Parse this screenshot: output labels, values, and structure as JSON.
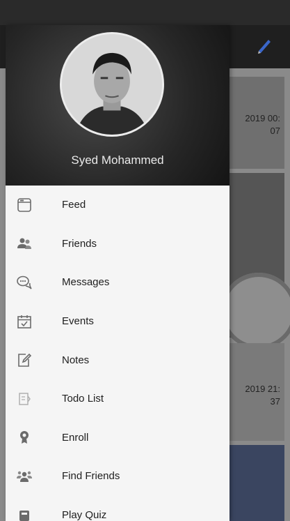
{
  "user": {
    "name": "Syed Mohammed"
  },
  "background": {
    "post_dates": [
      {
        "line1": "2019 00:",
        "line2": "07"
      },
      {
        "line1": "2019 21:",
        "line2": "37"
      }
    ]
  },
  "drawer": {
    "items": [
      {
        "label": "Feed",
        "icon": "feed-icon"
      },
      {
        "label": "Friends",
        "icon": "friends-icon"
      },
      {
        "label": "Messages",
        "icon": "messages-icon"
      },
      {
        "label": "Events",
        "icon": "events-icon"
      },
      {
        "label": "Notes",
        "icon": "notes-icon"
      },
      {
        "label": "Todo List",
        "icon": "todo-list-icon"
      },
      {
        "label": "Enroll",
        "icon": "enroll-icon"
      },
      {
        "label": "Find Friends",
        "icon": "find-friends-icon"
      },
      {
        "label": "Play Quiz",
        "icon": "quiz-icon"
      }
    ]
  },
  "colors": {
    "drawer_bg": "#f5f5f5",
    "header_bg": "#1e1e1e",
    "status_bar": "#2a2a2a",
    "icon_gray": "#6b6b6b"
  }
}
